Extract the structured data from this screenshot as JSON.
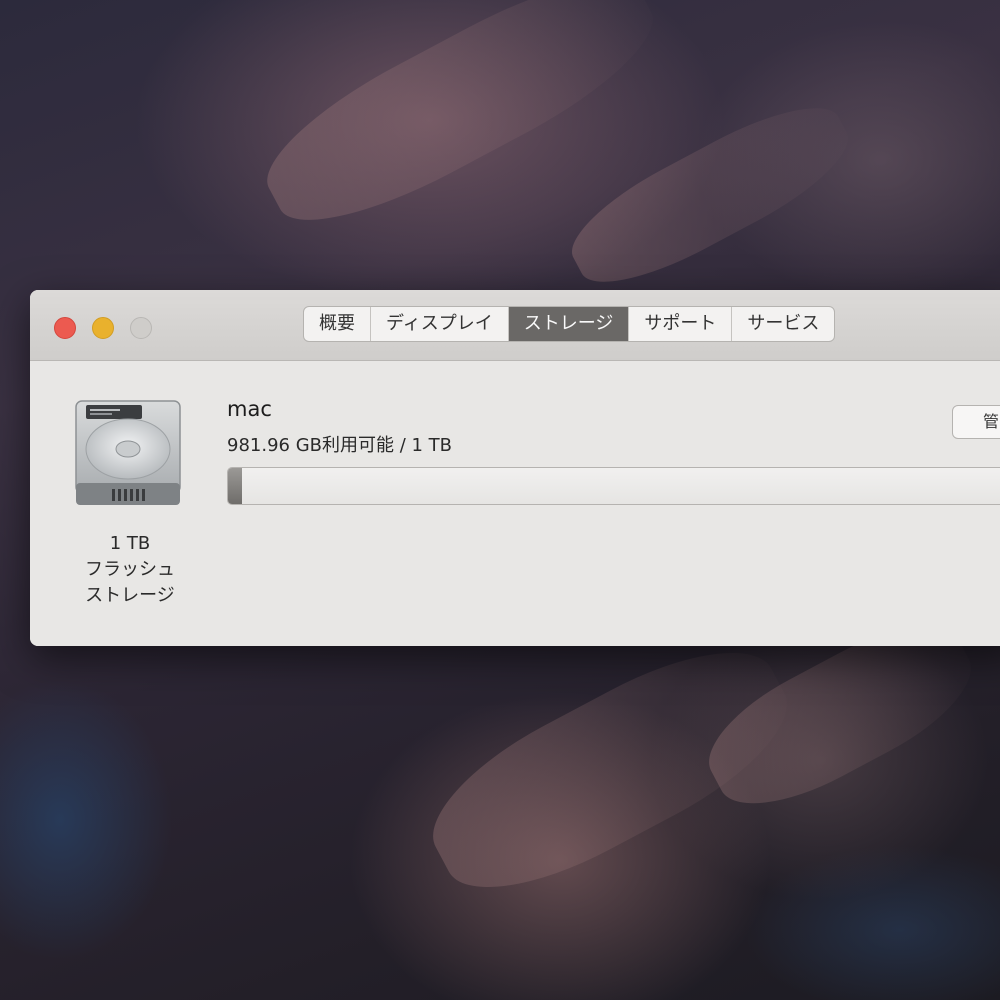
{
  "window": {
    "tabs": [
      {
        "label": "概要"
      },
      {
        "label": "ディスプレイ"
      },
      {
        "label": "ストレージ"
      },
      {
        "label": "サポート"
      },
      {
        "label": "サービス"
      }
    ],
    "active_tab": "ストレージ"
  },
  "storage": {
    "disk_caption": [
      "1 TB",
      "フラッシュ",
      "ストレージ"
    ],
    "volume_name": "mac",
    "usage_text": "981.96 GB利用可能 / 1 TB",
    "used_fraction": 0.018,
    "manage_button_label": "管"
  },
  "colors": {
    "close": "#ec5a50",
    "minimize": "#e9b12d",
    "zoom_disabled": "#cfcdca",
    "active_tab": "#6a6866"
  }
}
